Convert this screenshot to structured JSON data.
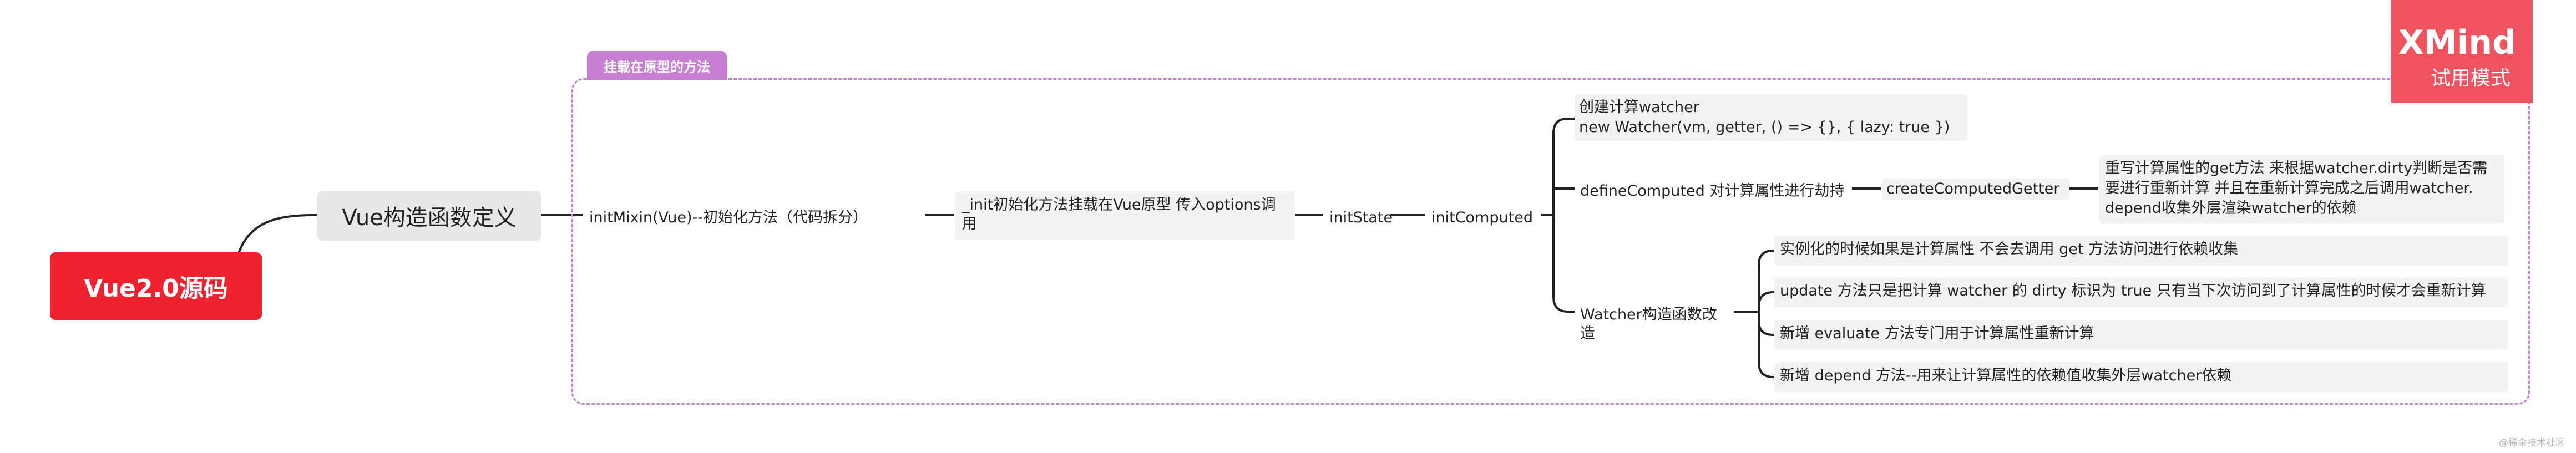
{
  "watermark": {
    "brand": "XMind",
    "mode": "试用模式"
  },
  "credit": "@稀金技术社区",
  "root": "Vue2.0源码",
  "main_topic": "Vue构造函数定义",
  "frame_label": "挂载在原型的方法",
  "nodes": {
    "init_mixin": "initMixin(Vue)--初始化方法（代码拆分）",
    "init_proto": "_init初始化方法挂载在Vue原型 传入options调\n用",
    "init_state": "initState",
    "init_computed": "initComputed",
    "create_watcher": "创建计算watcher\n new Watcher(vm, getter, () => {}, { lazy: true })",
    "define_computed": "defineComputed 对计算属性进行劫持",
    "create_getter": "createComputedGetter",
    "getter_detail": "重写计算属性的get方法 来根据watcher.dirty判断是否需\n要进行重新计算 并且在重新计算完成之后调用watcher.\ndepend收集外层渲染watcher的依赖",
    "watcher_mod": "Watcher构造函数改造",
    "mod_items": [
      "实例化的时候如果是计算属性 不会去调用 get 方法访问进行依赖收集",
      "update 方法只是把计算 watcher 的 dirty 标识为 true 只有当下次访问到了计算属性的时候才会重新计算",
      "新增 evaluate 方法专门用于计算属性重新计算",
      "新增 depend 方法--用来让计算属性的依赖值收集外层watcher依赖"
    ]
  }
}
